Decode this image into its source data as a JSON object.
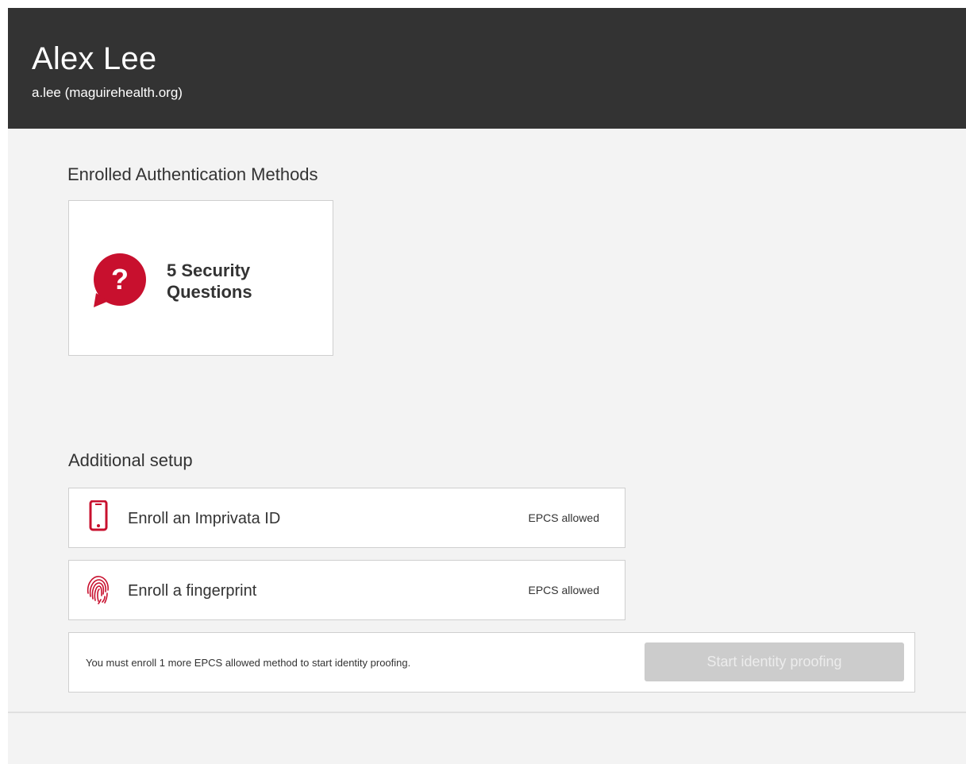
{
  "header": {
    "user_name": "Alex Lee",
    "account": "a.lee (maguirehealth.org)"
  },
  "enrolled": {
    "title": "Enrolled Authentication Methods",
    "methods": [
      {
        "label": "5 Security Questions",
        "icon": "question-bubble-icon"
      }
    ]
  },
  "additional": {
    "title": "Additional setup",
    "rows": [
      {
        "label": "Enroll an Imprivata ID",
        "badge": "EPCS allowed",
        "icon": "mobile-phone-icon"
      },
      {
        "label": "Enroll a fingerprint",
        "badge": "EPCS allowed",
        "icon": "fingerprint-icon"
      }
    ]
  },
  "identity_proofing": {
    "message": "You must enroll 1 more EPCS allowed method to start identity proofing.",
    "button_label": "Start identity proofing",
    "button_enabled": false
  },
  "colors": {
    "header_bg": "#333333",
    "page_bg": "#f3f3f3",
    "accent_red": "#c8102e",
    "disabled_button": "#cccccc"
  }
}
